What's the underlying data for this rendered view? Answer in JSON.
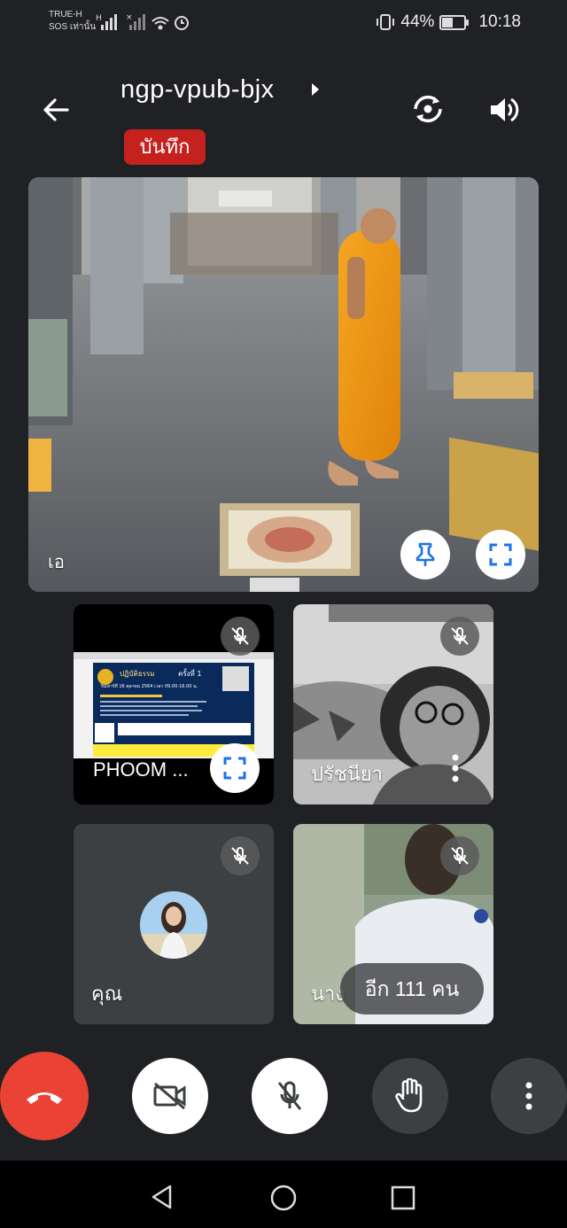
{
  "status_bar": {
    "carrier_line1": "TRUE-H",
    "carrier_line2": "SOS เท่านั้น",
    "battery_percent": "44%",
    "battery_level": 0.44,
    "time": "10:18"
  },
  "header": {
    "meeting_code": "ngp-vpub-bjx",
    "record_badge": "บันทึก"
  },
  "main_video": {
    "participant_name": "เอ"
  },
  "tiles": [
    {
      "name": "PHOOM ...",
      "muted": true
    },
    {
      "name": "ปรัชนียา",
      "muted": true
    },
    {
      "name": "คุณ",
      "muted": true
    },
    {
      "name": "นาง",
      "muted": true
    }
  ],
  "more_participants": "อีก 111 คน",
  "slide": {
    "title": "ปฏิบัติธรรม",
    "title_suffix": "ครั้งที่ 1",
    "date_line": "วันเสาร์ที่ 16 ตุลาคม 2564 เวลา 09.00-16.00 น."
  },
  "colors": {
    "background": "#202124",
    "record_red": "#c5221f",
    "hangup_red": "#ea4335",
    "tile_bg": "#3c4043"
  },
  "icons": {
    "back": "arrow-left-icon",
    "rotate_camera": "camera-rotate-icon",
    "speaker": "volume-icon",
    "pin": "pin-icon",
    "fullscreen": "fullscreen-icon",
    "mic_off": "mic-off-icon",
    "hangup": "phone-hangup-icon",
    "camera_off": "video-off-icon",
    "raise_hand": "hand-icon",
    "more": "more-vertical-icon"
  }
}
